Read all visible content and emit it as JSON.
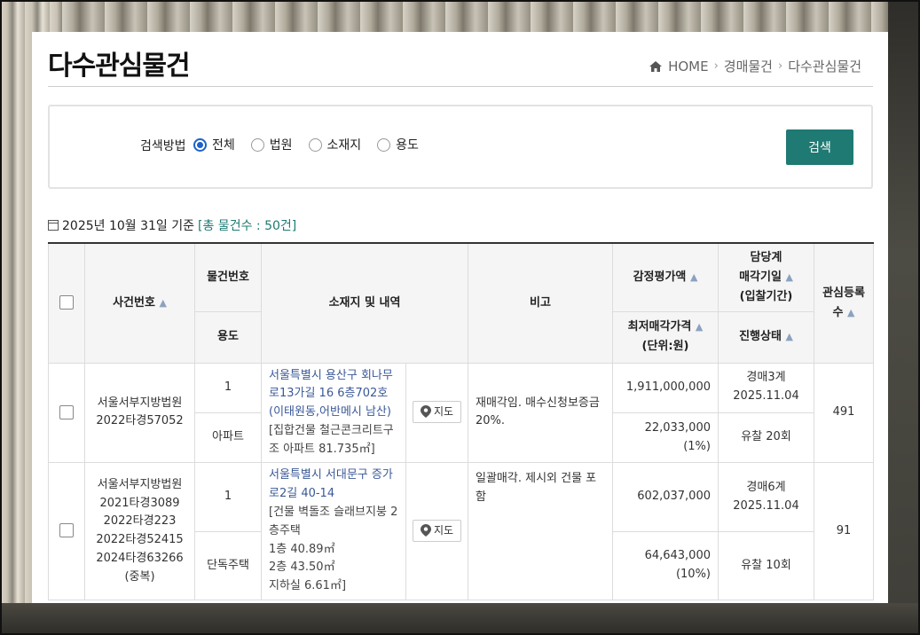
{
  "page": {
    "title": "다수관심물건",
    "breadcrumb": [
      "HOME",
      "경매물건",
      "다수관심물건"
    ]
  },
  "search": {
    "label": "검색방법",
    "options": [
      {
        "label": "전체",
        "checked": true
      },
      {
        "label": "법원",
        "checked": false
      },
      {
        "label": "소재지",
        "checked": false
      },
      {
        "label": "용도",
        "checked": false
      }
    ],
    "button": "검색"
  },
  "summary": {
    "date_text": "2025년 10월 31일 기준",
    "total_text": "[총 물건수 : 50건]"
  },
  "table": {
    "headers": {
      "case_no": "사건번호",
      "item_no": "물건번호",
      "usage": "용도",
      "address": "소재지 및 내역",
      "remark": "비고",
      "appraisal": "감정평가액",
      "min_price": "최저매각가격",
      "min_price_unit": "(단위:원)",
      "dept": "담당계",
      "sale_date": "매각기일",
      "sale_period": "(입찰기간)",
      "status": "진행상태",
      "interest": "관심등록",
      "interest2": "수"
    },
    "rows": [
      {
        "court": "서울서부지방법원",
        "case_numbers": [
          "2022타경57052"
        ],
        "item_no": "1",
        "usage": "아파트",
        "address_link": "서울특별시 용산구 회나무로13가길 16 6층702호 (이태원동,어반메시 남산)",
        "address_detail": [
          "[집합건물 철근콘크리트구조 아파트 81.735㎡]"
        ],
        "map_label": "지도",
        "remark": "재매각임. 매수신청보증금 20%.",
        "appraisal": "1,911,000,000",
        "min_price": "22,033,000",
        "min_pct": "(1%)",
        "dept": "경매3계",
        "sale_date": "2025.11.04",
        "status": "유찰 20회",
        "interest": "491"
      },
      {
        "court": "서울서부지방법원",
        "case_numbers": [
          "2021타경3089",
          "2022타경223",
          "2022타경52415",
          "2024타경63266",
          "(중복)"
        ],
        "item_no": "1",
        "usage": "단독주택",
        "address_link": "서울특별시 서대문구 증가로2길 40-14",
        "address_detail": [
          "[건물 벽돌조 슬래브지붕 2층주택",
          "1층 40.89㎡",
          "2층 43.50㎡",
          "지하실 6.61㎡]"
        ],
        "map_label": "지도",
        "remark": "일괄매각. 제시외 건물 포함",
        "appraisal": "602,037,000",
        "min_price": "64,643,000",
        "min_pct": "(10%)",
        "dept": "경매6계",
        "sale_date": "2025.11.04",
        "status": "유찰 10회",
        "interest": "91"
      }
    ]
  },
  "colors": {
    "accent": "#1f7a73",
    "radio": "#1b62c9",
    "link": "#3b5998",
    "sort_arrow": "#8aa2c0"
  },
  "sort_arrow_glyph": "▲"
}
